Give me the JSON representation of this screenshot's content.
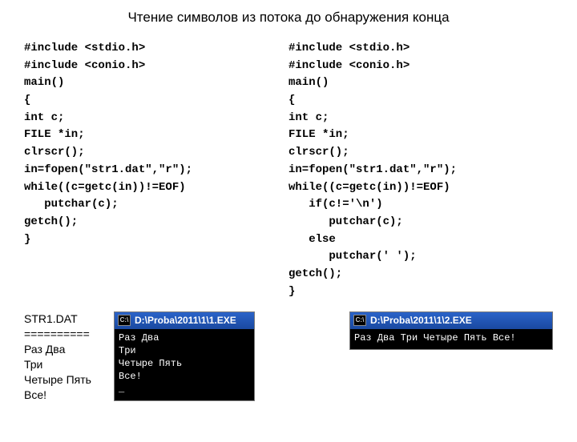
{
  "title": "Чтение символов из потока до обнаружения конца",
  "code_left": "#include <stdio.h>\n#include <conio.h>\nmain()\n{\nint c;\nFILE *in;\nclrscr();\nin=fopen(\"str1.dat\",\"r\");\nwhile((c=getc(in))!=EOF)\n   putchar(c);\ngetch();\n}",
  "code_right": "#include <stdio.h>\n#include <conio.h>\nmain()\n{\nint c;\nFILE *in;\nclrscr();\nin=fopen(\"str1.dat\",\"r\");\nwhile((c=getc(in))!=EOF)\n   if(c!='\\n')\n      putchar(c);\n   else\n      putchar(' ');\ngetch();\n}",
  "strdat": "STR1.DAT\n==========\nРаз Два\nТри\nЧетыре Пять\nВсе!",
  "console1": {
    "icon": "C:\\",
    "title": "D:\\Proba\\2011\\1\\1.EXE",
    "output": "Раз Два\nТри\nЧетыре Пять\nВсе!\n_"
  },
  "console2": {
    "icon": "C:\\",
    "title": "D:\\Proba\\2011\\1\\2.EXE",
    "output": "Раз Два Три Четыре Пять Все!"
  }
}
